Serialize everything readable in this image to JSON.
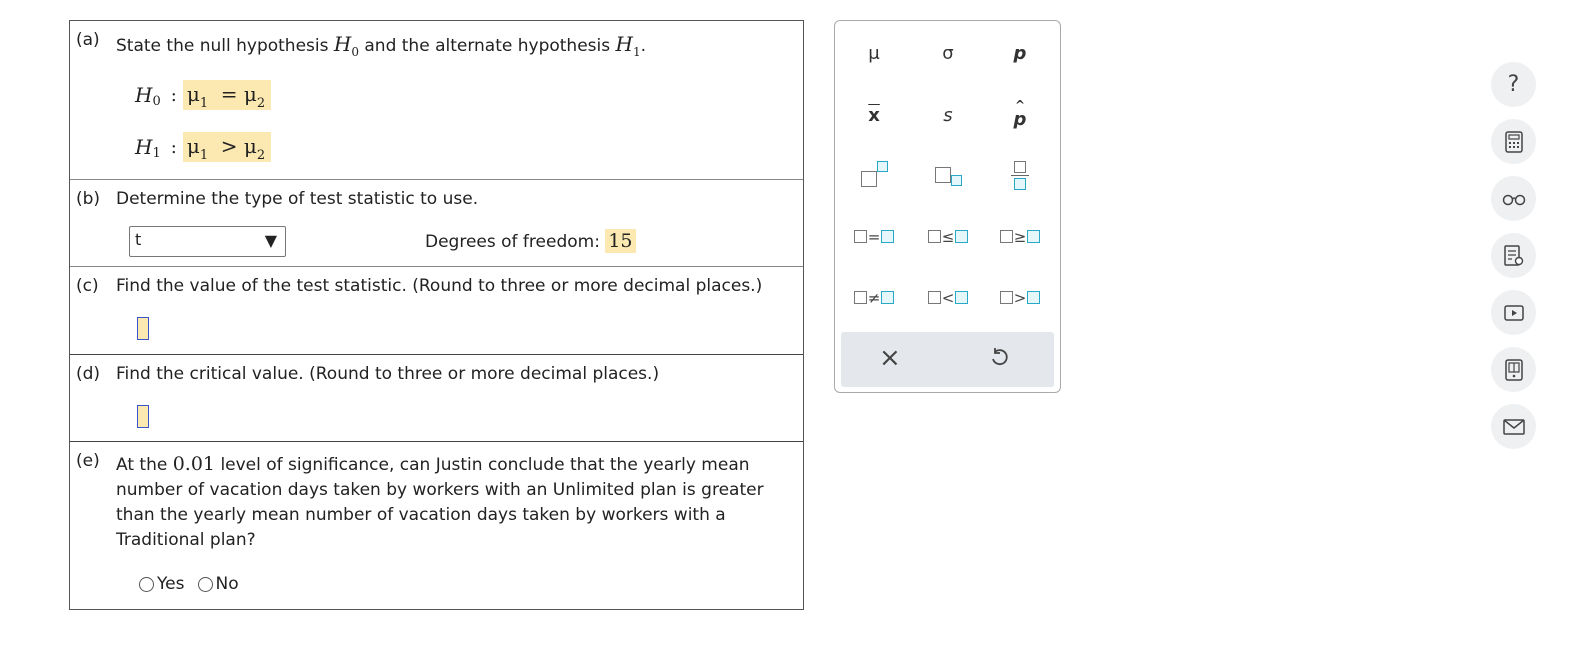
{
  "parts": {
    "a": {
      "label": "(a)",
      "text_before": "State the null hypothesis",
      "text_mid": "and the alternate hypothesis",
      "text_end": ".",
      "h0_sym": "H",
      "h0_sub": "0",
      "h1_sym": "H",
      "h1_sub": "1",
      "h0_expr": "μ1 = μ2",
      "h1_expr": "μ1 > μ2"
    },
    "b": {
      "label": "(b)",
      "text": "Determine the type of test statistic to use.",
      "select_value": "t",
      "df_label": "Degrees of freedom:",
      "df_value": "15"
    },
    "c": {
      "label": "(c)",
      "text": "Find the value of the test statistic. (Round to three or more decimal places.)"
    },
    "d": {
      "label": "(d)",
      "text": "Find the critical value. (Round to three or more decimal places.)"
    },
    "e": {
      "label": "(e)",
      "line1_pre": "At the",
      "alpha": "0.01",
      "line1_post": "level of significance, can Justin conclude that the yearly mean",
      "line2": "number of vacation days taken by workers with an Unlimited plan is greater",
      "line3": "than the yearly mean number of vacation days taken by workers with a",
      "line4": "Traditional plan?",
      "yes": "Yes",
      "no": "No"
    }
  },
  "palette": {
    "mu": "μ",
    "sigma": "σ",
    "p": "p",
    "xbar": "x",
    "s": "s",
    "phat": "p",
    "eq": "=",
    "le": "≤",
    "ge": "≥",
    "ne": "≠",
    "lt": "<",
    "gt": ">",
    "clear": "×"
  },
  "rail": {
    "help": "?"
  },
  "colors": {
    "highlight": "#fbe9b1",
    "accent": "#2aa8c8",
    "cursor": "#3a55c8"
  },
  "icons": [
    "help-icon",
    "calculator-icon",
    "glasses-icon",
    "notes-icon",
    "video-icon",
    "ebook-icon",
    "mail-icon"
  ]
}
